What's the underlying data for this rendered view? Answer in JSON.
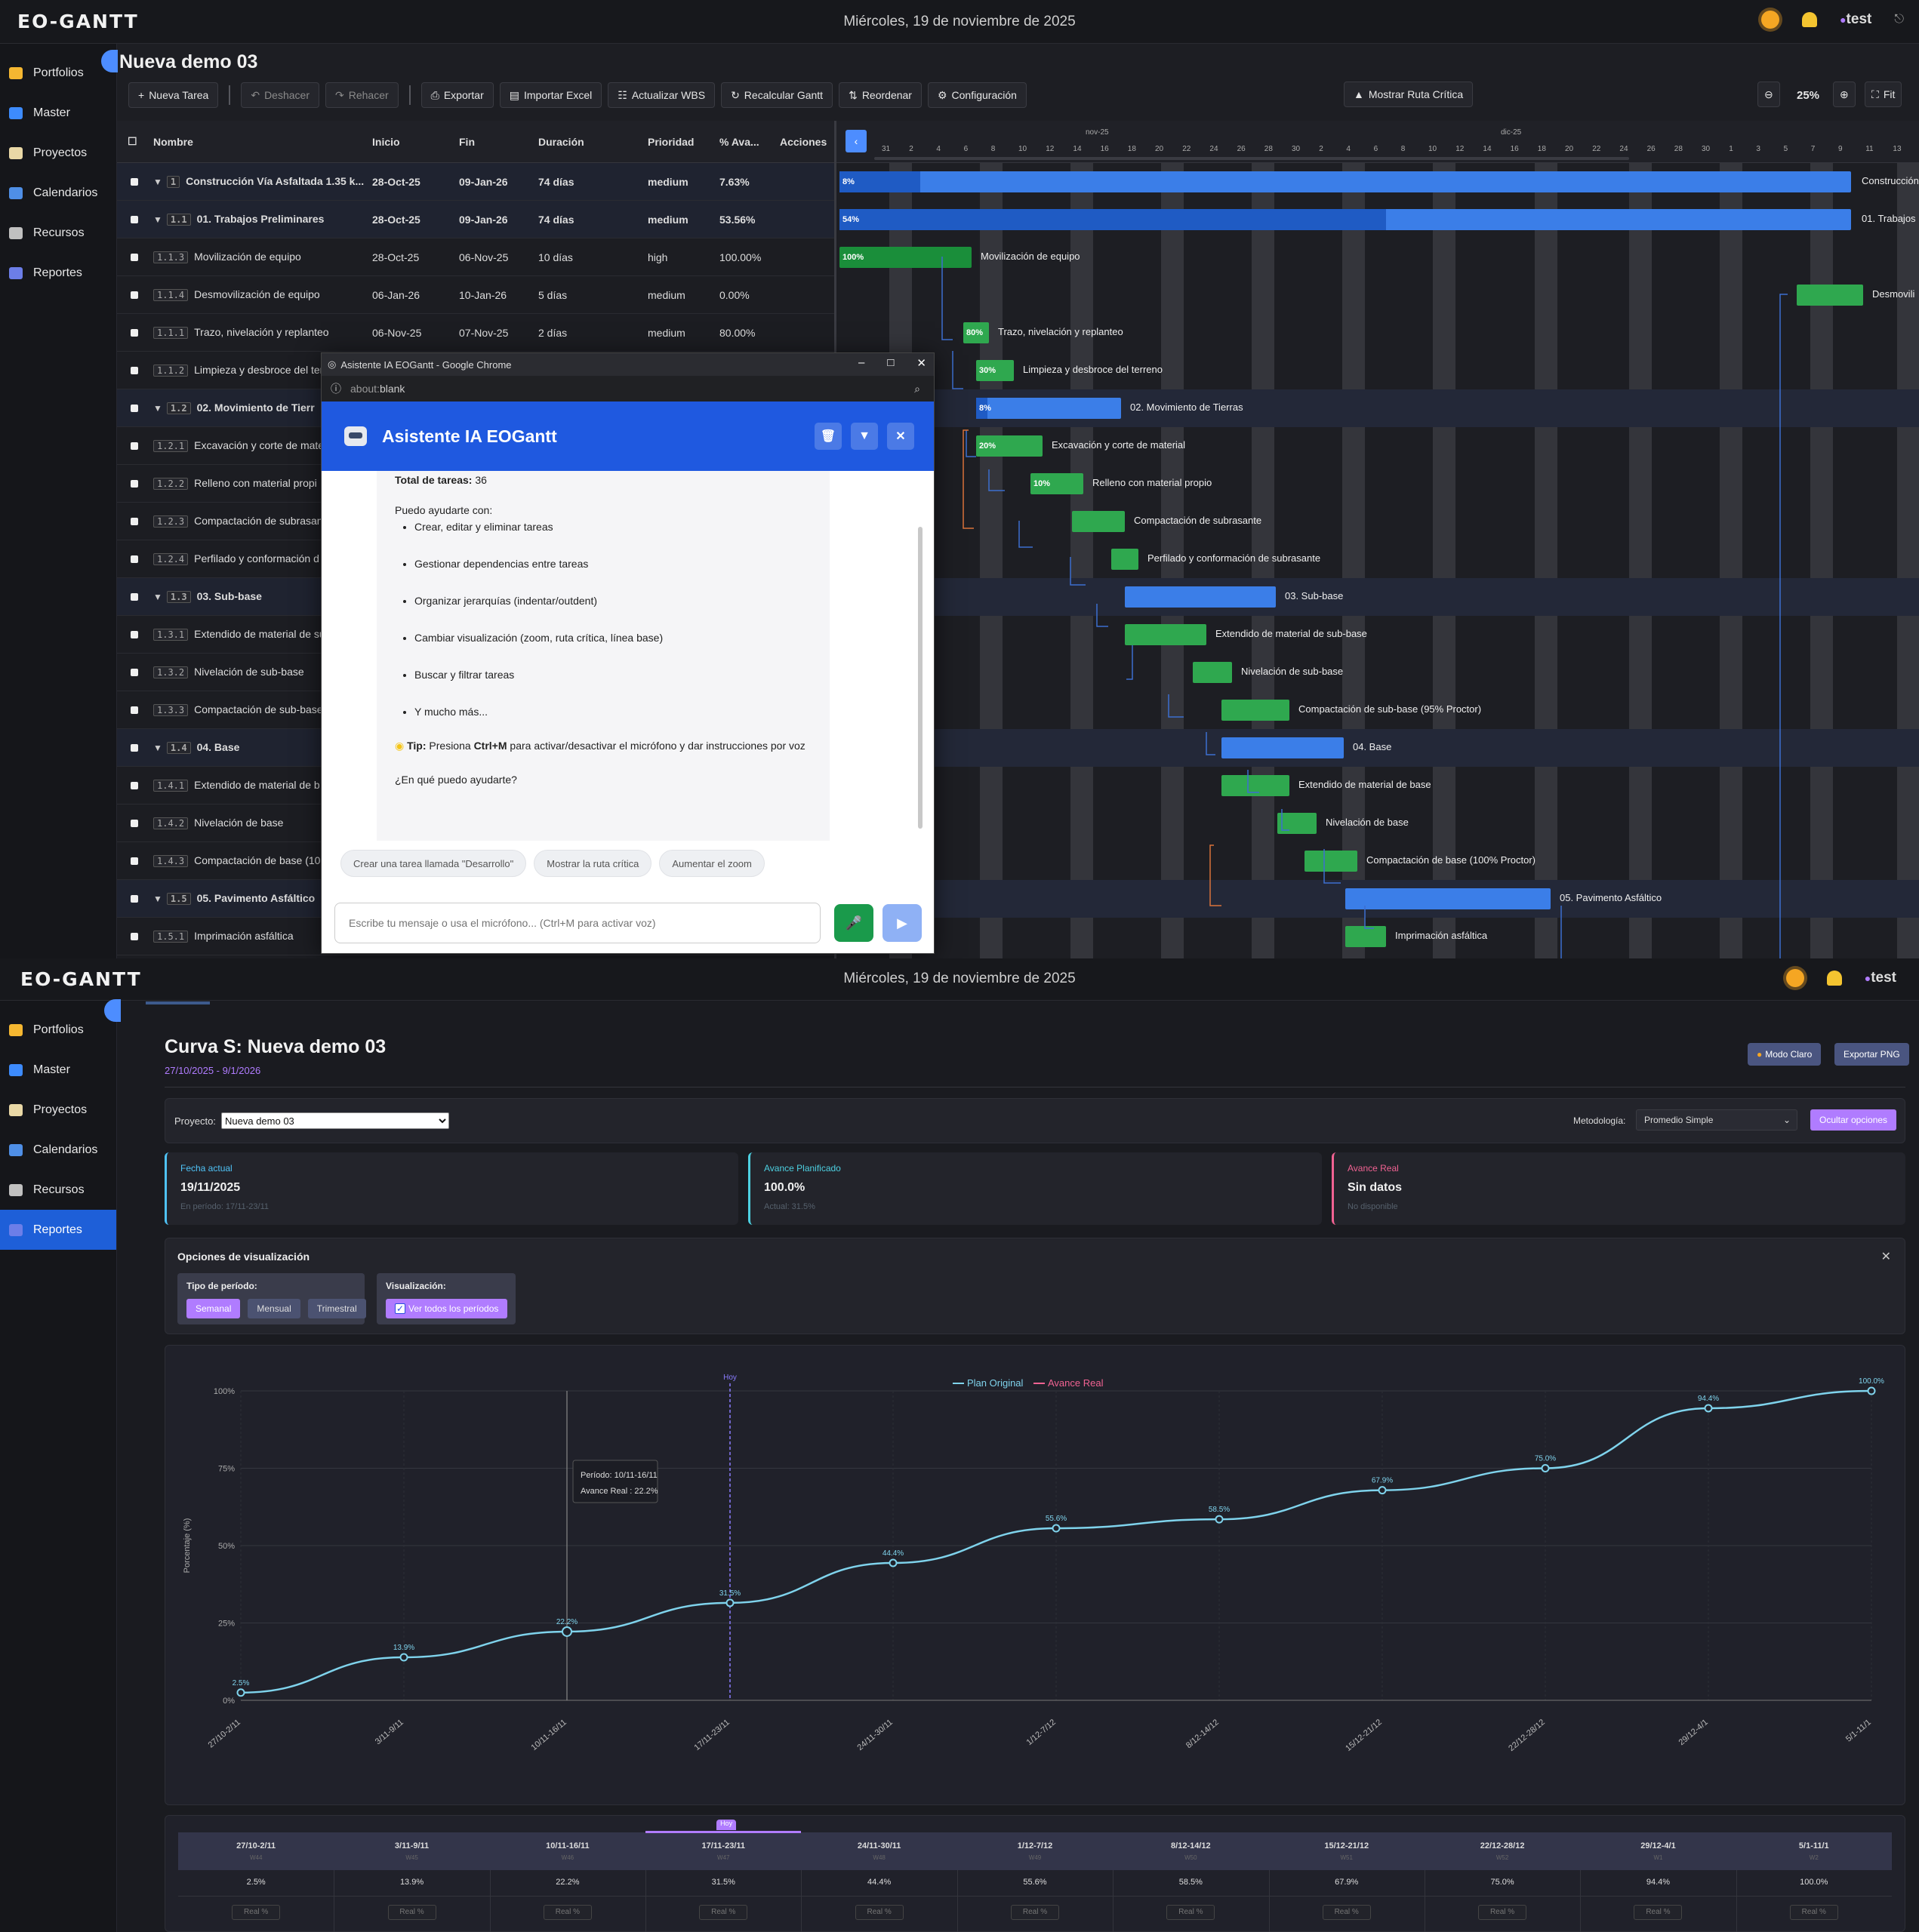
{
  "app": {
    "brand": "EO-GANTT",
    "date": "Miércoles, 19 de noviembre de 2025",
    "user": "test"
  },
  "sidebar": {
    "items": [
      {
        "label": "Portfolios",
        "icon": "folder-icon",
        "color": "#f5b731"
      },
      {
        "label": "Master",
        "icon": "globe-icon",
        "color": "#3d8bfd"
      },
      {
        "label": "Proyectos",
        "icon": "clipboard-icon",
        "color": "#e9d8a6"
      },
      {
        "label": "Calendarios",
        "icon": "calendar-icon",
        "color": "#4f8fe6"
      },
      {
        "label": "Recursos",
        "icon": "tools-icon",
        "color": "#c0c0c0"
      },
      {
        "label": "Reportes",
        "icon": "chart-icon",
        "color": "#6c7ee8"
      }
    ]
  },
  "gantt_view": {
    "title": "Nueva demo 03",
    "toolbar": {
      "new_task": "Nueva Tarea",
      "undo": "Deshacer",
      "redo": "Rehacer",
      "export": "Exportar",
      "import_excel": "Importar Excel",
      "update_wbs": "Actualizar WBS",
      "recalc": "Recalcular Gantt",
      "reorder": "Reordenar",
      "config": "Configuración",
      "critical_path": "Mostrar Ruta Crítica",
      "zoom": "25%",
      "fit": "Fit"
    },
    "columns": [
      "Nombre",
      "Inicio",
      "Fin",
      "Duración",
      "Prioridad",
      "% Ava...",
      "Acciones"
    ],
    "timeline": {
      "month1": "nov-25",
      "month2": "dic-25",
      "days": [
        "31",
        "2",
        "4",
        "6",
        "8",
        "10",
        "12",
        "14",
        "16",
        "18",
        "20",
        "22",
        "24",
        "26",
        "28",
        "30",
        "2",
        "4",
        "6",
        "8",
        "10",
        "12",
        "14",
        "16",
        "18",
        "20",
        "22",
        "24",
        "26",
        "28",
        "30",
        "1",
        "3",
        "5",
        "7",
        "9",
        "11",
        "13"
      ]
    },
    "rows": [
      {
        "wbs": "1",
        "name": "Construcción Vía Asfaltada 1.35 k...",
        "start": "28-Oct-25",
        "end": "09-Jan-26",
        "dur": "74 días",
        "prio": "medium",
        "pct": "7.63%",
        "summary": true
      },
      {
        "wbs": "1.1",
        "name": "01. Trabajos Preliminares",
        "start": "28-Oct-25",
        "end": "09-Jan-26",
        "dur": "74 días",
        "prio": "medium",
        "pct": "53.56%",
        "summary": true
      },
      {
        "wbs": "1.1.3",
        "name": "Movilización de equipo",
        "start": "28-Oct-25",
        "end": "06-Nov-25",
        "dur": "10 días",
        "prio": "high",
        "pct": "100.00%"
      },
      {
        "wbs": "1.1.4",
        "name": "Desmovilización de equipo",
        "start": "06-Jan-26",
        "end": "10-Jan-26",
        "dur": "5 días",
        "prio": "medium",
        "pct": "0.00%"
      },
      {
        "wbs": "1.1.1",
        "name": "Trazo, nivelación y replanteo",
        "start": "06-Nov-25",
        "end": "07-Nov-25",
        "dur": "2 días",
        "prio": "medium",
        "pct": "80.00%"
      },
      {
        "wbs": "1.1.2",
        "name": "Limpieza y desbroce del ter",
        "start": "",
        "end": "",
        "dur": "",
        "prio": "",
        "pct": ""
      },
      {
        "wbs": "1.2",
        "name": "02. Movimiento de Tierr",
        "start": "",
        "end": "",
        "dur": "",
        "prio": "",
        "pct": "",
        "summary": true
      },
      {
        "wbs": "1.2.1",
        "name": "Excavación y corte de mate",
        "start": "",
        "end": "",
        "dur": "",
        "prio": "",
        "pct": ""
      },
      {
        "wbs": "1.2.2",
        "name": "Relleno con material propi",
        "start": "",
        "end": "",
        "dur": "",
        "prio": "",
        "pct": ""
      },
      {
        "wbs": "1.2.3",
        "name": "Compactación de subrasan",
        "start": "",
        "end": "",
        "dur": "",
        "prio": "",
        "pct": ""
      },
      {
        "wbs": "1.2.4",
        "name": "Perfilado y conformación d",
        "start": "",
        "end": "",
        "dur": "",
        "prio": "",
        "pct": ""
      },
      {
        "wbs": "1.3",
        "name": "03. Sub-base",
        "start": "",
        "end": "",
        "dur": "",
        "prio": "",
        "pct": "",
        "summary": true
      },
      {
        "wbs": "1.3.1",
        "name": "Extendido de material de su",
        "start": "",
        "end": "",
        "dur": "",
        "prio": "",
        "pct": ""
      },
      {
        "wbs": "1.3.2",
        "name": "Nivelación de sub-base",
        "start": "",
        "end": "",
        "dur": "",
        "prio": "",
        "pct": ""
      },
      {
        "wbs": "1.3.3",
        "name": "Compactación de sub-base",
        "start": "",
        "end": "",
        "dur": "",
        "prio": "",
        "pct": ""
      },
      {
        "wbs": "1.4",
        "name": "04. Base",
        "start": "",
        "end": "",
        "dur": "",
        "prio": "",
        "pct": "",
        "summary": true
      },
      {
        "wbs": "1.4.1",
        "name": "Extendido de material de b",
        "start": "",
        "end": "",
        "dur": "",
        "prio": "",
        "pct": ""
      },
      {
        "wbs": "1.4.2",
        "name": "Nivelación de base",
        "start": "",
        "end": "",
        "dur": "",
        "prio": "",
        "pct": ""
      },
      {
        "wbs": "1.4.3",
        "name": "Compactación de base (100",
        "start": "",
        "end": "",
        "dur": "",
        "prio": "",
        "pct": ""
      },
      {
        "wbs": "1.5",
        "name": "05. Pavimento Asfáltico",
        "start": "",
        "end": "",
        "dur": "",
        "prio": "",
        "pct": "",
        "summary": true
      },
      {
        "wbs": "1.5.1",
        "name": "Imprimación asfáltica",
        "start": "",
        "end": "",
        "dur": "",
        "prio": "",
        "pct": ""
      }
    ],
    "bars": [
      {
        "label": "Construcción",
        "pct": "8%",
        "progress": 0.08,
        "color": "b"
      },
      {
        "label": "01. Trabajos",
        "pct": "54%",
        "progress": 0.54,
        "color": "b"
      },
      {
        "label": "Movilización de equipo",
        "pct": "100%",
        "progress": 1,
        "color": "gd"
      },
      {
        "label": "Desmovili",
        "pct": "",
        "progress": 0,
        "color": "g"
      },
      {
        "label": "Trazo, nivelación y replanteo",
        "pct": "80%",
        "progress": 0.8,
        "color": "g"
      },
      {
        "label": "Limpieza y desbroce del terreno",
        "pct": "30%",
        "progress": 0.3,
        "color": "g"
      },
      {
        "label": "02. Movimiento de Tierras",
        "pct": "8%",
        "progress": 0.08,
        "color": "b"
      },
      {
        "label": "Excavación y corte de material",
        "pct": "20%",
        "progress": 0.2,
        "color": "g"
      },
      {
        "label": "Relleno con material propio",
        "pct": "10%",
        "progress": 0.1,
        "color": "g"
      },
      {
        "label": "Compactación de subrasante",
        "pct": "",
        "progress": 0,
        "color": "g"
      },
      {
        "label": "Perfilado y conformación de subrasante",
        "pct": "",
        "progress": 0,
        "color": "g"
      },
      {
        "label": "03. Sub-base",
        "pct": "",
        "progress": 0,
        "color": "b"
      },
      {
        "label": "Extendido de material de sub-base",
        "pct": "",
        "progress": 0,
        "color": "g"
      },
      {
        "label": "Nivelación de sub-base",
        "pct": "",
        "progress": 0,
        "color": "g"
      },
      {
        "label": "Compactación de sub-base (95% Proctor)",
        "pct": "",
        "progress": 0,
        "color": "g"
      },
      {
        "label": "04. Base",
        "pct": "",
        "progress": 0,
        "color": "b"
      },
      {
        "label": "Extendido de material de base",
        "pct": "",
        "progress": 0,
        "color": "g"
      },
      {
        "label": "Nivelación de base",
        "pct": "",
        "progress": 0,
        "color": "g"
      },
      {
        "label": "Compactación de base (100% Proctor)",
        "pct": "",
        "progress": 0,
        "color": "g"
      },
      {
        "label": "05. Pavimento Asfáltico",
        "pct": "",
        "progress": 0,
        "color": "b"
      },
      {
        "label": "Imprimación asfáltica",
        "pct": "",
        "progress": 0,
        "color": "g"
      }
    ]
  },
  "chat": {
    "window_title": "Asistente IA EOGantt - Google Chrome",
    "url_prefix": "about:",
    "url": "blank",
    "title": "Asistente IA EOGantt",
    "total_label": "Total de tareas:",
    "total_value": "36",
    "intro": "Puedo ayudarte con:",
    "bullets": [
      "Crear, editar y eliminar tareas",
      "Gestionar dependencias entre tareas",
      "Organizar jerarquías (indentar/outdent)",
      "Cambiar visualización (zoom, ruta crítica, línea base)",
      "Buscar y filtrar tareas",
      "Y mucho más..."
    ],
    "tip_label": "Tip:",
    "tip_pre": "Presiona",
    "tip_key": "Ctrl+M",
    "tip_post": "para activar/desactivar el micrófono y dar instrucciones por voz",
    "question": "¿En qué puedo ayudarte?",
    "suggestions": [
      "Crear una tarea llamada \"Desarrollo\"",
      "Mostrar la ruta crítica",
      "Aumentar el zoom"
    ],
    "placeholder": "Escribe tu mensaje o usa el micrófono... (Ctrl+M para activar voz)"
  },
  "scurve": {
    "title": "Curva S: Nueva demo 03",
    "dates": "27/10/2025 - 9/1/2026",
    "btn_light": "Modo Claro",
    "btn_export": "Exportar PNG",
    "project_label": "Proyecto:",
    "project_value": "Nueva demo 03",
    "method_label": "Metodología:",
    "method_value": "Promedio Simple",
    "hide_options": "Ocultar opciones",
    "kpis": [
      {
        "label": "Fecha actual",
        "value": "19/11/2025",
        "sub": "En período: 17/11-23/11",
        "color": "#4fc3f7"
      },
      {
        "label": "Avance Planificado",
        "value": "100.0%",
        "sub": "Actual: 31.5%",
        "color": "#4dd0e1"
      },
      {
        "label": "Avance Real",
        "value": "Sin datos",
        "sub": "No disponible",
        "color": "#f06292"
      }
    ],
    "options_title": "Opciones de visualización",
    "period_label": "Tipo de período:",
    "period_options": [
      "Semanal",
      "Mensual",
      "Trimestral"
    ],
    "vis_label": "Visualización:",
    "vis_option": "Ver todos los períodos",
    "tooltip_period": "Período: 10/11-16/11",
    "tooltip_value": "Avance Real : 22.2%",
    "today": "Hoy",
    "table_weeks": [
      "W44",
      "W45",
      "W46",
      "W47",
      "W48",
      "W49",
      "W50",
      "W51",
      "W52",
      "W1",
      "W2"
    ],
    "table_input": "Real %"
  },
  "chart_data": {
    "type": "line",
    "title": "",
    "ylabel": "Porcentaje (%)",
    "xlabel": "",
    "categories": [
      "27/10-2/11",
      "3/11-9/11",
      "10/11-16/11",
      "17/11-23/11",
      "24/11-30/11",
      "1/12-7/12",
      "8/12-14/12",
      "15/12-21/12",
      "22/12-28/12",
      "29/12-4/1",
      "5/1-11/1"
    ],
    "series": [
      {
        "name": "Plan Original",
        "color": "#7fd3ec",
        "values": [
          2.5,
          13.9,
          22.2,
          31.5,
          44.4,
          55.6,
          58.5,
          67.9,
          75.0,
          94.4,
          100.0
        ],
        "labels": [
          "2.5%",
          "13.9%",
          "22.2%",
          "31.5%",
          "44.4%",
          "55.6%",
          "58.5%",
          "67.9%",
          "75.0%",
          "94.4%",
          "100.0%"
        ]
      },
      {
        "name": "Avance Real",
        "color": "#f06292",
        "values": []
      }
    ],
    "yticks": [
      "0%",
      "25%",
      "50%",
      "75%",
      "100%"
    ],
    "ylim": [
      0,
      100
    ],
    "grid": true,
    "legend": "top-center"
  }
}
